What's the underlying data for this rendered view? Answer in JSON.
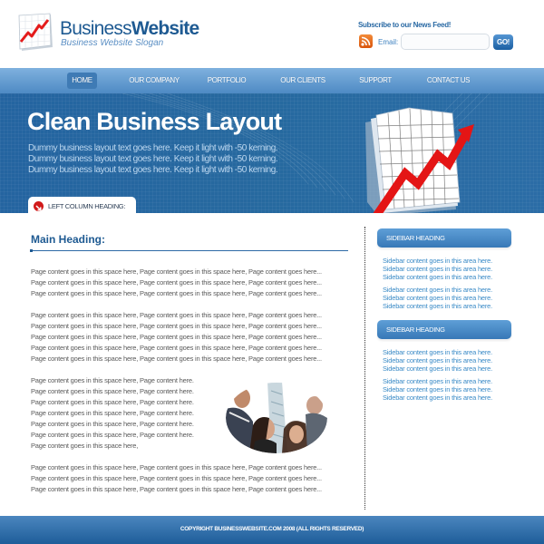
{
  "header": {
    "brand_light": "Business",
    "brand_bold": "Website",
    "slogan": "Business Website Slogan",
    "subscribe_title": "Subscribe to our News Feed!",
    "email_label": "Email:",
    "email_value": "",
    "email_placeholder": "",
    "go_label": "GO!",
    "rss_icon": "rss-feed-icon",
    "logo_icon": "rising-chart-icon"
  },
  "nav": {
    "items": [
      {
        "label": "HOME",
        "active": true
      },
      {
        "label": "OUR COMPANY",
        "active": false
      },
      {
        "label": "PORTFOLIO",
        "active": false
      },
      {
        "label": "OUR CLIENTS",
        "active": false
      },
      {
        "label": "SUPPORT",
        "active": false
      },
      {
        "label": "CONTACT US",
        "active": false
      }
    ]
  },
  "hero": {
    "title": "Clean Business Layout",
    "lines": [
      "Dummy business layout text goes here. Keep it light with -50 kerning.",
      "Dummy business layout text goes here. Keep it light with -50 kerning.",
      "Dummy business layout text goes here. Keep it light with -50 kerning."
    ],
    "left_column_heading": "LEFT COLUMN HEADING:",
    "image_icon": "growth-chart-graphic"
  },
  "main": {
    "heading": "Main Heading:",
    "paragraphs": [
      [
        "Page content goes in this space here, Page content goes in this space here, Page content goes here...",
        "Page content goes in this space here, Page content goes in this space here, Page content goes here...",
        "Page content goes in this space here, Page content goes in this space here, Page content goes here..."
      ],
      [
        "Page content goes in this space here, Page content goes in this space here, Page content goes here...",
        "Page content goes in this space here, Page content goes in this space here, Page content goes here...",
        "Page content goes in this space here, Page content goes in this space here, Page content goes here...",
        "Page content goes in this space here, Page content goes in this space here, Page content goes here...",
        "Page content goes in this space here, Page content goes in this space here, Page content goes here..."
      ],
      [
        "Page content goes in this space here, Page content here.",
        "Page content goes in this space here, Page content here.",
        "Page content goes in this space here, Page content here.",
        "Page content goes in this space here, Page content here.",
        "Page content goes in this space here, Page content here.",
        "Page content goes in this space here, Page content here.",
        "Page content goes in this space here,"
      ],
      [
        "Page content goes in this space here, Page content goes in this space here, Page content goes here...",
        "Page content goes in this space here, Page content goes in this space here, Page content goes here...",
        "Page content goes in this space here, Page content goes in this space here, Page content goes here..."
      ]
    ],
    "photo": "people-looking-up-photo"
  },
  "sidebar": {
    "sections": [
      {
        "heading": "SIDEBAR HEADING",
        "blocks": [
          [
            "Sidebar content goes in this area here.",
            "Sidebar content goes in this area here.",
            "Sidebar content goes in this area here."
          ],
          [
            "Sidebar content goes in this area here.",
            "Sidebar content goes in this area here.",
            "Sidebar content goes in this area here."
          ]
        ]
      },
      {
        "heading": "SIDEBAR HEADING",
        "blocks": [
          [
            "Sidebar content goes in this area here.",
            "Sidebar content goes in this area here.",
            "Sidebar content goes in this area here."
          ],
          [
            "Sidebar content goes in this area here.",
            "Sidebar content goes in this area here.",
            "Sidebar content goes in this area here."
          ]
        ]
      }
    ]
  },
  "footer": {
    "copyright": "COPYRIGHT BUSINESSWEBSITE.COM 2008 (ALL RIGHTS RESERVED)"
  },
  "colors": {
    "brand_blue": "#1e5a92",
    "nav_blue": "#5f9bd2",
    "hero_blue": "#26699f",
    "accent_red": "#e02020",
    "sidebar_text": "#3b8bc7",
    "body_text": "#5a5a5a"
  }
}
